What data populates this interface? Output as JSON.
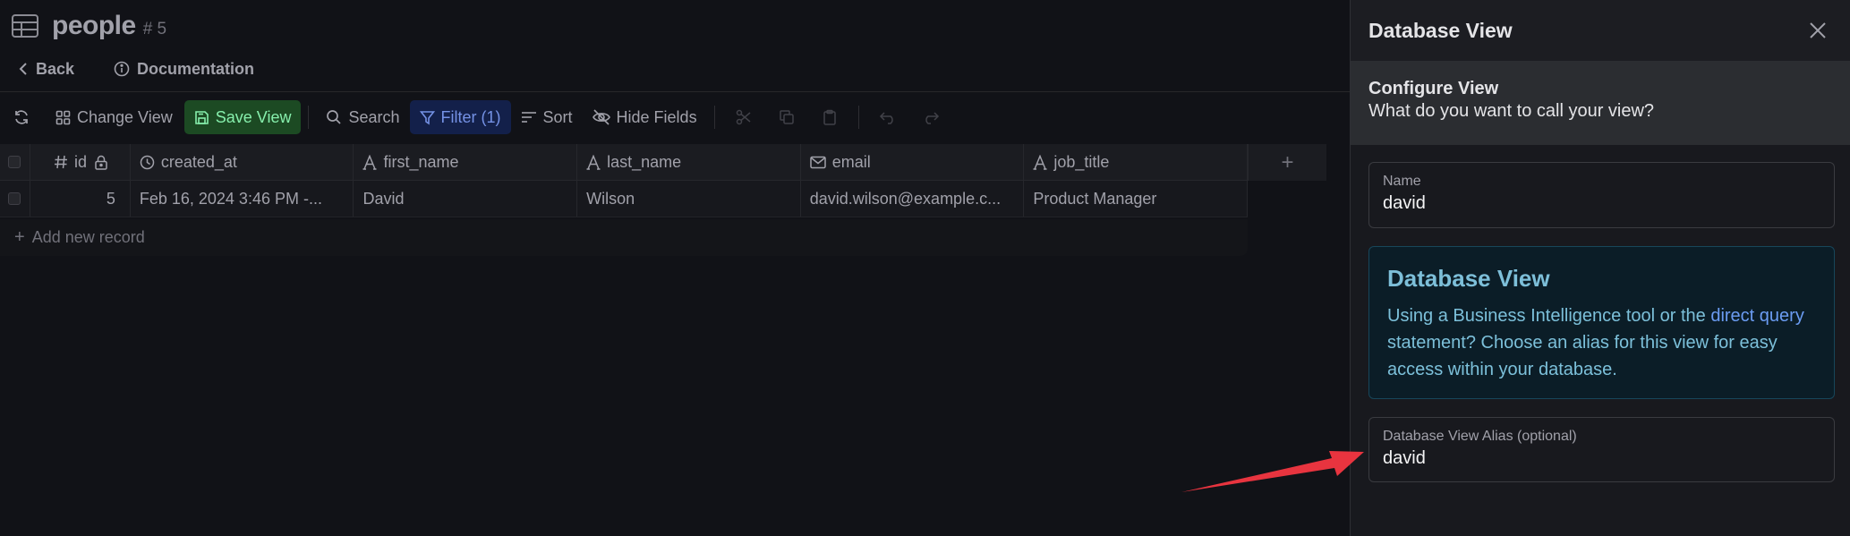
{
  "page": {
    "title": "people",
    "id_label": "# 5",
    "back_label": "Back",
    "documentation_label": "Documentation"
  },
  "toolbar": {
    "change_view_label": "Change View",
    "save_view_label": "Save View",
    "search_label": "Search",
    "filter_label": "Filter (1)",
    "sort_label": "Sort",
    "hide_fields_label": "Hide Fields"
  },
  "grid": {
    "columns": [
      "id",
      "created_at",
      "first_name",
      "last_name",
      "email",
      "job_title"
    ],
    "rows": [
      {
        "id": "5",
        "created_at": "Feb 16, 2024 3:46 PM -...",
        "first_name": "David",
        "last_name": "Wilson",
        "email": "david.wilson@example.c...",
        "job_title": "Product Manager"
      }
    ],
    "add_record_label": "Add new record",
    "add_column_label": "+"
  },
  "panel": {
    "title": "Database View",
    "configure_title": "Configure View",
    "configure_question": "What do you want to call your view?",
    "name_label": "Name",
    "name_value": "david",
    "info_title": "Database View",
    "info_text_before": "Using a Business Intelligence tool or the ",
    "info_link": "direct query",
    "info_text_after": " statement? Choose an alias for this view for easy access within your database.",
    "alias_label": "Database View Alias (optional)",
    "alias_value": "david"
  },
  "colors": {
    "background": "#111217",
    "save_button": "#1c4a23",
    "filter_button": "#13204a",
    "info_box": "#0b1d27",
    "info_text": "#7cc0da",
    "link": "#6b9cf2",
    "annotation_arrow": "#e8343f"
  },
  "icons": [
    "table-icon",
    "chevron-left-icon",
    "info-icon",
    "refresh-icon",
    "grid-icon",
    "save-icon",
    "search-icon",
    "filter-icon",
    "sort-icon",
    "eye-off-icon",
    "scissors-icon",
    "copy-icon",
    "clipboard-icon",
    "undo-icon",
    "redo-icon",
    "hash-icon",
    "lock-icon",
    "clock-icon",
    "text-icon",
    "mail-icon",
    "close-icon",
    "arrow-annotation"
  ]
}
